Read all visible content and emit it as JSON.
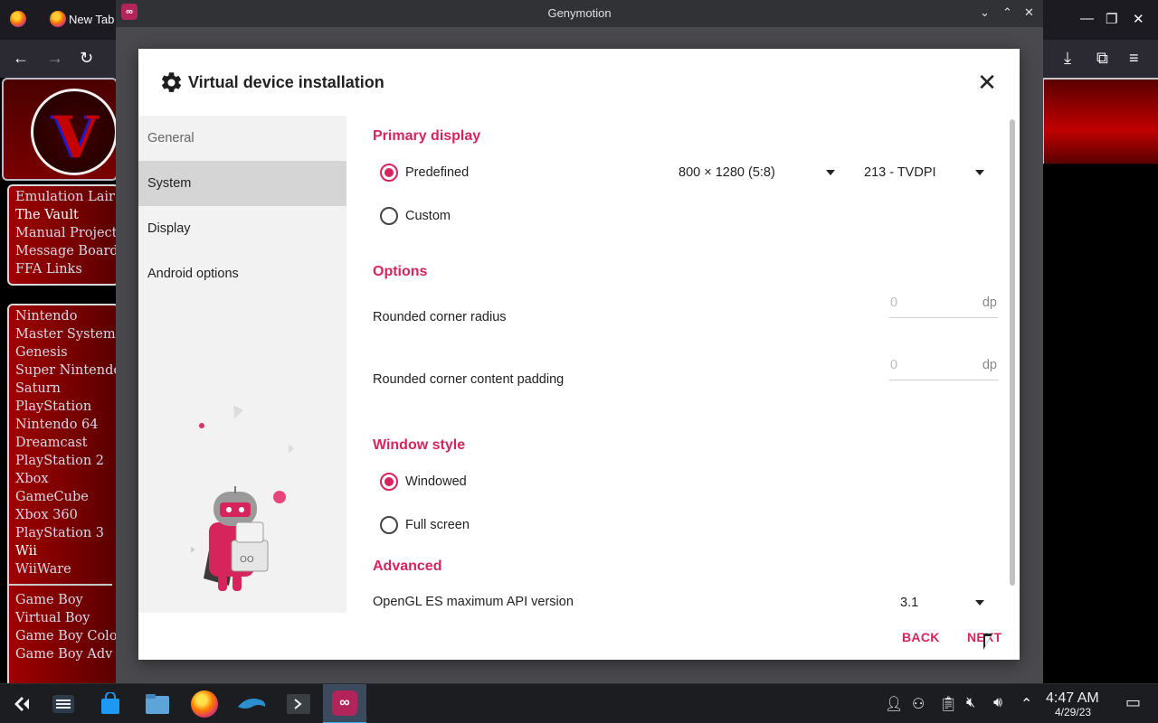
{
  "browser": {
    "tab_title": "New Tab",
    "sidebar_menu_1": [
      "Emulation Lair",
      "The Vault",
      "Manual Project",
      "Message Boards",
      "FFA Links"
    ],
    "sidebar_menu_2": [
      "Nintendo",
      "Master System",
      "Genesis",
      "Super Nintendo",
      "Saturn",
      "PlayStation",
      "Nintendo 64",
      "Dreamcast",
      "PlayStation 2",
      "Xbox",
      "GameCube",
      "Xbox 360",
      "PlayStation 3",
      "Wii",
      "WiiWare"
    ],
    "sidebar_menu_3": [
      "Game Boy",
      "Virtual Boy",
      "Game Boy Color",
      "Game Boy Adv"
    ]
  },
  "genymotion": {
    "window_title": "Genymotion"
  },
  "dialog": {
    "title": "Virtual device installation",
    "nav": [
      "General",
      "System",
      "Display",
      "Android options"
    ],
    "active_nav": "Display",
    "primary_display": {
      "heading": "Primary display",
      "predefined_label": "Predefined",
      "resolution": "800 × 1280 (5:8)",
      "density": "213 - TVDPI",
      "custom_label": "Custom",
      "selected": "Predefined"
    },
    "options": {
      "heading": "Options",
      "corner_radius_label": "Rounded corner radius",
      "corner_radius_value": "0",
      "corner_padding_label": "Rounded corner content padding",
      "corner_padding_value": "0",
      "unit": "dp"
    },
    "window_style": {
      "heading": "Window style",
      "windowed_label": "Windowed",
      "fullscreen_label": "Full screen",
      "selected": "Windowed"
    },
    "advanced": {
      "heading": "Advanced",
      "opengl_label": "OpenGL ES maximum API version",
      "opengl_value": "3.1"
    },
    "back_label": "BACK",
    "next_label": "NEXT",
    "accent_color": "#d6245c"
  },
  "taskbar": {
    "time": "4:47 AM",
    "date": "4/29/23"
  }
}
